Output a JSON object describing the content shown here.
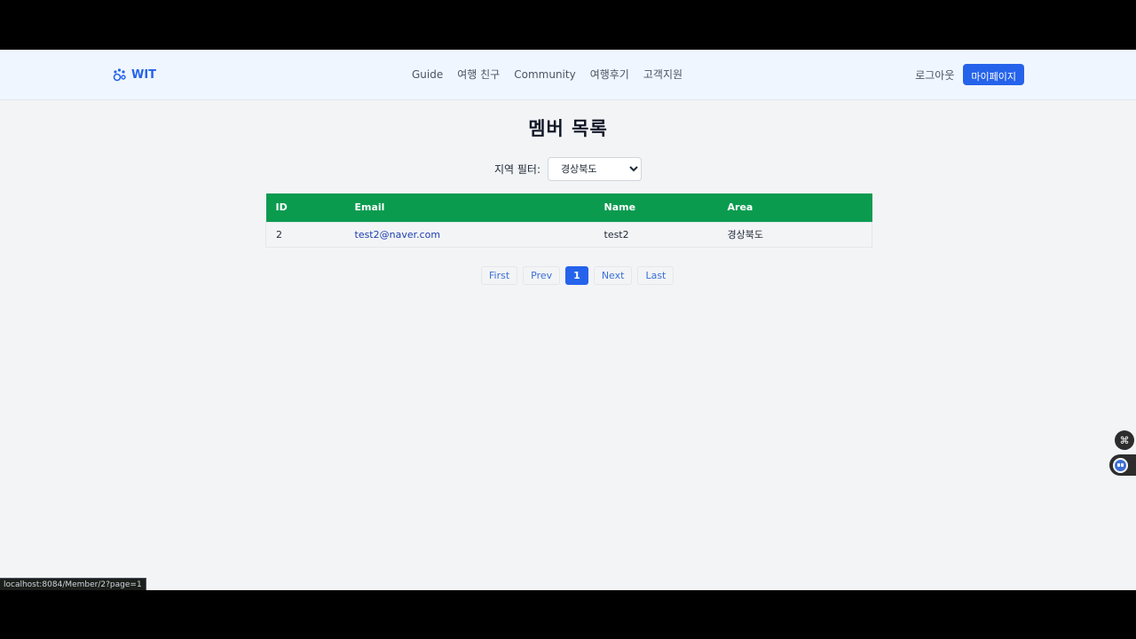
{
  "brand": {
    "name": "WIT"
  },
  "nav": {
    "links": [
      "Guide",
      "여행 친구",
      "Community",
      "여행후기",
      "고객지원"
    ],
    "logout": "로그아웃",
    "mypage": "마이페이지"
  },
  "page": {
    "title": "멤버 목록",
    "filter_label": "지역 필터:",
    "filter_selected": "경상북도"
  },
  "table": {
    "headers": [
      "ID",
      "Email",
      "Name",
      "Area"
    ],
    "rows": [
      {
        "id": "2",
        "email": "test2@naver.com",
        "name": "test2",
        "area": "경상북도"
      }
    ]
  },
  "pagination": {
    "first": "First",
    "prev": "Prev",
    "current": "1",
    "next": "Next",
    "last": "Last"
  },
  "status_bar": {
    "url": "localhost:8084/Member/2?page=1"
  },
  "colors": {
    "accent": "#2563eb",
    "table_header": "#0a9b4f",
    "nav_bg": "#eff6ff"
  }
}
